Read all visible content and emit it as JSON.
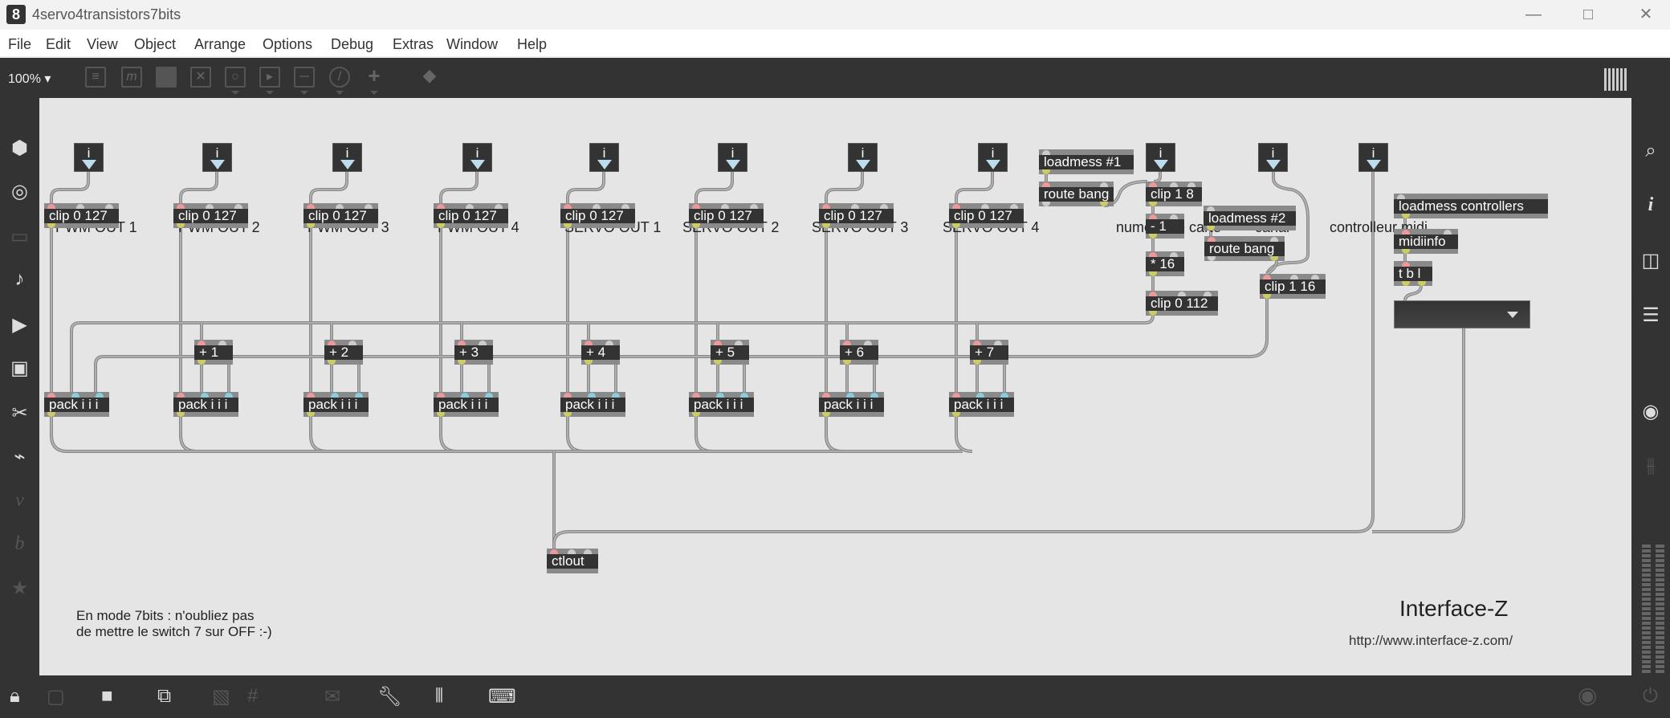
{
  "window": {
    "title": "4servo4transistors7bits",
    "controls": [
      "minimize",
      "maximize",
      "close"
    ]
  },
  "menu": [
    "File",
    "Edit",
    "View",
    "Object",
    "Arrange",
    "Options",
    "Debug",
    "Extras",
    "Window",
    "Help"
  ],
  "toolbar": {
    "zoom": "100%",
    "icons": [
      "presentation-icon",
      "message-icon",
      "comment-icon",
      "toggle-icon",
      "button-icon",
      "play-icon",
      "slider-icon",
      "dial-icon",
      "add-icon",
      "paint-bucket-icon"
    ]
  },
  "sidebar_left": [
    "object-cube-icon",
    "target-icon",
    "console-icon",
    "music-note-icon",
    "media-icon",
    "image-icon",
    "paperclip-icon",
    "plug-icon",
    "vizzie-icon",
    "beap-icon",
    "star-icon"
  ],
  "sidebar_right": [
    "search-icon",
    "info-icon",
    "split-view-icon",
    "list-icon",
    "snapshot-icon",
    "mixer-icon"
  ],
  "patch": {
    "labels": {
      "pwm1": "PWM OUT 1",
      "pwm2": "PWM OUT 2",
      "pwm3": "PWM OUT 3",
      "pwm4": "PWM OUT 4",
      "servo1": "SERVO OUT 1",
      "servo2": "SERVO OUT 2",
      "servo3": "SERVO OUT 3",
      "servo4": "SERVO OUT 4",
      "card": "numéro de carte",
      "channel": "canal",
      "controller": "controlleur midi"
    },
    "numbox_glyph": "i",
    "objects": {
      "clip": "clip 0 127",
      "pack": "pack i i i",
      "plus1": "+ 1",
      "plus2": "+ 2",
      "plus3": "+ 3",
      "plus4": "+ 4",
      "plus5": "+ 5",
      "plus6": "+ 6",
      "plus7": "+ 7",
      "ctlout": "ctlout",
      "loadmess1": "loadmess #1",
      "routebang1": "route bang",
      "clip18": "clip 1 8",
      "minus1": "- 1",
      "times16": "* 16",
      "clip0112": "clip 0 112",
      "loadmess2": "loadmess #2",
      "routebang2": "route bang",
      "clip116": "clip 1 16",
      "loadmess_ctrl": "loadmess controllers",
      "midiinfo": "midiinfo",
      "tbl": "t b l"
    },
    "umenu_value": "",
    "note_line1": "En mode 7bits : n'oubliez pas",
    "note_line2": "de mettre le switch 7 sur OFF :-)",
    "brand": "Interface-Z",
    "url": "http://www.interface-z.com/"
  },
  "bottombar": [
    "lock-icon",
    "presentation-select-icon",
    "presentation-mode-icon",
    "new-view-icon",
    "grid-toggle-icon",
    "grid-icon",
    "attach-icon",
    "wrench-icon",
    "piano-icon",
    "keyboard-icon",
    "transport-icon",
    "power-icon"
  ]
}
